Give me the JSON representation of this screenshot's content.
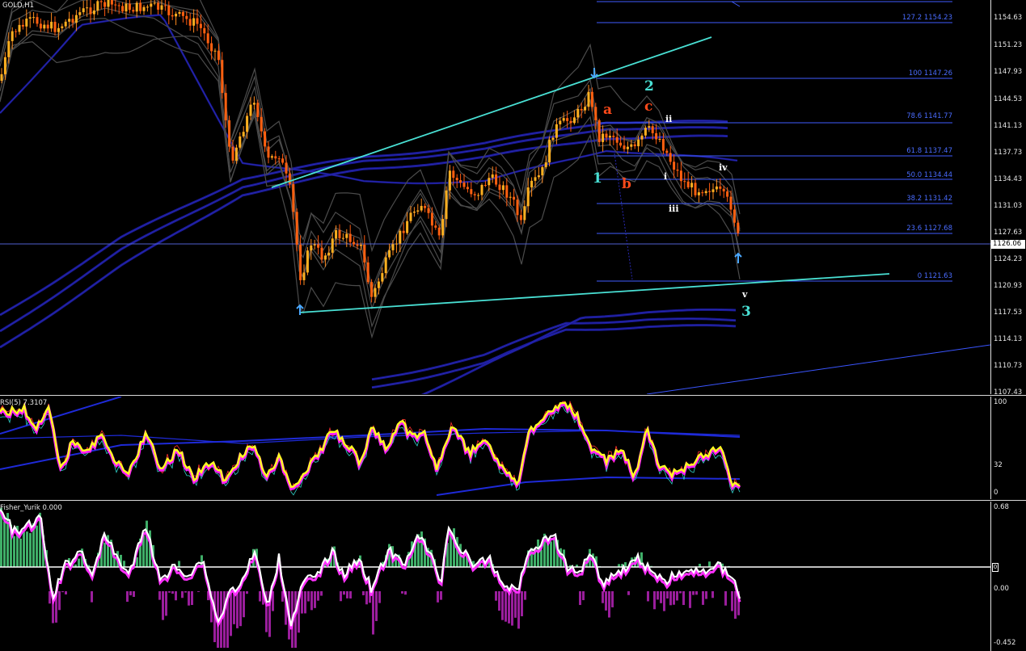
{
  "main": {
    "title": "GOLD,H1",
    "price_scale": [
      "1154.63",
      "1151.23",
      "1147.93",
      "1144.53",
      "1141.13",
      "1137.73",
      "1134.43",
      "1131.03",
      "1127.63",
      "1124.23",
      "1120.93",
      "1117.53",
      "1114.13",
      "1110.73",
      "1107.43"
    ],
    "current_price": "1126.06",
    "fib_levels": [
      {
        "label": "127.2  1154.23"
      },
      {
        "label": "100  1147.26"
      },
      {
        "label": "78.6  1141.77"
      },
      {
        "label": "61.8  1137.47"
      },
      {
        "label": "50.0  1134.44"
      },
      {
        "label": "38.2  1131.42"
      },
      {
        "label": "23.6  1127.68"
      },
      {
        "label": "0  1121.63"
      }
    ],
    "wave_labels": {
      "w1": "1",
      "w2": "2",
      "w3": "3",
      "a": "a",
      "b": "b",
      "c": "c",
      "i": "i",
      "ii": "ii",
      "iii": "iii",
      "iv": "iv",
      "v": "v"
    },
    "colors": {
      "bull": "#ff8a1e",
      "bear": "#ff5a10",
      "channel": "#49e0d4",
      "fib": "#3f5cff",
      "band": "#4b4b4b",
      "ma": "#1c1c9c"
    }
  },
  "rsi": {
    "title": "RSI(5) 7.3107",
    "scale": [
      "100",
      "32",
      "0"
    ]
  },
  "fisher": {
    "title": "Fisher_Yurik 0.000",
    "scale": [
      "0.68",
      "0.00",
      "-0.452"
    ],
    "level_marker": "0"
  }
}
